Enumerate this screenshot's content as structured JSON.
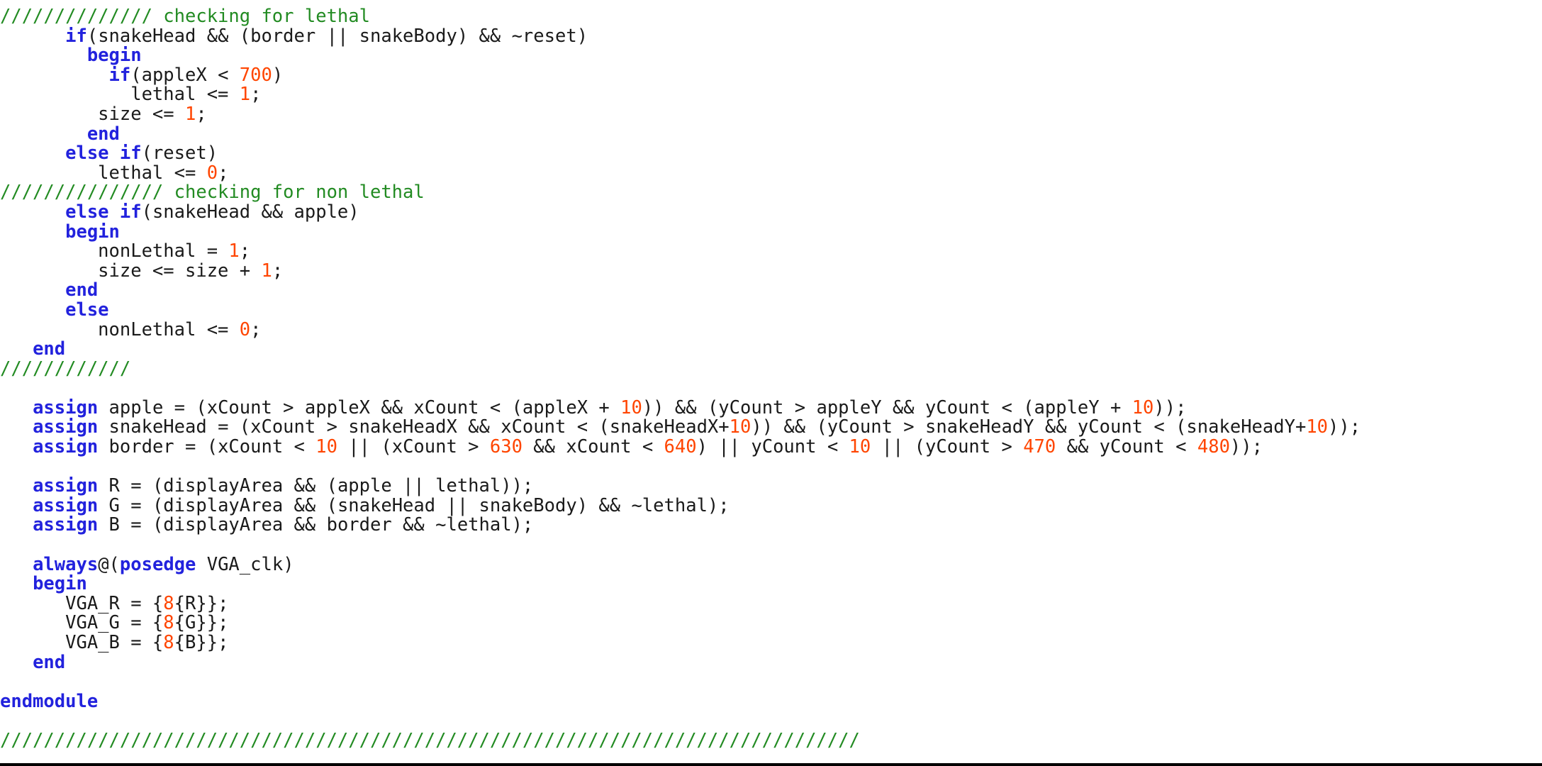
{
  "document": {
    "language": "Verilog",
    "background_color": "#ffffff",
    "colors": {
      "comment": "#228B22",
      "keyword": "#2222dd",
      "number": "#ff4500",
      "text": "#1a1a1a",
      "rule": "#000000"
    },
    "lines": [
      {
        "indent": 0,
        "tokens": [
          {
            "type": "comment",
            "text": "////////////// checking for lethal"
          }
        ]
      },
      {
        "indent": 0,
        "tokens": [
          {
            "type": "plain",
            "text": "      "
          },
          {
            "type": "keyword",
            "text": "if"
          },
          {
            "type": "plain",
            "text": "(snakeHead && (border || snakeBody) && ~reset)"
          }
        ]
      },
      {
        "indent": 0,
        "tokens": [
          {
            "type": "plain",
            "text": "        "
          },
          {
            "type": "keyword",
            "text": "begin"
          }
        ]
      },
      {
        "indent": 0,
        "tokens": [
          {
            "type": "plain",
            "text": "          "
          },
          {
            "type": "keyword",
            "text": "if"
          },
          {
            "type": "plain",
            "text": "(appleX < "
          },
          {
            "type": "number",
            "text": "700"
          },
          {
            "type": "plain",
            "text": ")"
          }
        ]
      },
      {
        "indent": 0,
        "tokens": [
          {
            "type": "plain",
            "text": "            lethal <= "
          },
          {
            "type": "number",
            "text": "1"
          },
          {
            "type": "plain",
            "text": ";"
          }
        ]
      },
      {
        "indent": 0,
        "tokens": [
          {
            "type": "plain",
            "text": "         size <= "
          },
          {
            "type": "number",
            "text": "1"
          },
          {
            "type": "plain",
            "text": ";"
          }
        ]
      },
      {
        "indent": 0,
        "tokens": [
          {
            "type": "plain",
            "text": "        "
          },
          {
            "type": "keyword",
            "text": "end"
          }
        ]
      },
      {
        "indent": 0,
        "tokens": [
          {
            "type": "plain",
            "text": "      "
          },
          {
            "type": "keyword",
            "text": "else if"
          },
          {
            "type": "plain",
            "text": "(reset)"
          }
        ]
      },
      {
        "indent": 0,
        "tokens": [
          {
            "type": "plain",
            "text": "         lethal <= "
          },
          {
            "type": "number",
            "text": "0"
          },
          {
            "type": "plain",
            "text": ";"
          }
        ]
      },
      {
        "indent": 0,
        "tokens": [
          {
            "type": "comment",
            "text": "/////////////// checking for non lethal"
          }
        ]
      },
      {
        "indent": 0,
        "tokens": [
          {
            "type": "plain",
            "text": "      "
          },
          {
            "type": "keyword",
            "text": "else if"
          },
          {
            "type": "plain",
            "text": "(snakeHead && apple)"
          }
        ]
      },
      {
        "indent": 0,
        "tokens": [
          {
            "type": "plain",
            "text": "      "
          },
          {
            "type": "keyword",
            "text": "begin"
          }
        ]
      },
      {
        "indent": 0,
        "tokens": [
          {
            "type": "plain",
            "text": "         nonLethal = "
          },
          {
            "type": "number",
            "text": "1"
          },
          {
            "type": "plain",
            "text": ";"
          }
        ]
      },
      {
        "indent": 0,
        "tokens": [
          {
            "type": "plain",
            "text": "         size <= size + "
          },
          {
            "type": "number",
            "text": "1"
          },
          {
            "type": "plain",
            "text": ";"
          }
        ]
      },
      {
        "indent": 0,
        "tokens": [
          {
            "type": "plain",
            "text": "      "
          },
          {
            "type": "keyword",
            "text": "end"
          }
        ]
      },
      {
        "indent": 0,
        "tokens": [
          {
            "type": "plain",
            "text": "      "
          },
          {
            "type": "keyword",
            "text": "else"
          }
        ]
      },
      {
        "indent": 0,
        "tokens": [
          {
            "type": "plain",
            "text": "         nonLethal <= "
          },
          {
            "type": "number",
            "text": "0"
          },
          {
            "type": "plain",
            "text": ";"
          }
        ]
      },
      {
        "indent": 0,
        "tokens": [
          {
            "type": "plain",
            "text": "   "
          },
          {
            "type": "keyword",
            "text": "end"
          }
        ]
      },
      {
        "indent": 0,
        "tokens": [
          {
            "type": "comment",
            "text": "////////////"
          }
        ]
      },
      {
        "indent": 0,
        "tokens": []
      },
      {
        "indent": 0,
        "tokens": [
          {
            "type": "plain",
            "text": "   "
          },
          {
            "type": "keyword",
            "text": "assign"
          },
          {
            "type": "plain",
            "text": " apple = (xCount > appleX && xCount < (appleX + "
          },
          {
            "type": "number",
            "text": "10"
          },
          {
            "type": "plain",
            "text": ")) && (yCount > appleY && yCount < (appleY + "
          },
          {
            "type": "number",
            "text": "10"
          },
          {
            "type": "plain",
            "text": "));"
          }
        ]
      },
      {
        "indent": 0,
        "tokens": [
          {
            "type": "plain",
            "text": "   "
          },
          {
            "type": "keyword",
            "text": "assign"
          },
          {
            "type": "plain",
            "text": " snakeHead = (xCount > snakeHeadX && xCount < (snakeHeadX+"
          },
          {
            "type": "number",
            "text": "10"
          },
          {
            "type": "plain",
            "text": ")) && (yCount > snakeHeadY && yCount < (snakeHeadY+"
          },
          {
            "type": "number",
            "text": "10"
          },
          {
            "type": "plain",
            "text": "));"
          }
        ]
      },
      {
        "indent": 0,
        "tokens": [
          {
            "type": "plain",
            "text": "   "
          },
          {
            "type": "keyword",
            "text": "assign"
          },
          {
            "type": "plain",
            "text": " border = (xCount < "
          },
          {
            "type": "number",
            "text": "10"
          },
          {
            "type": "plain",
            "text": " || (xCount > "
          },
          {
            "type": "number",
            "text": "630"
          },
          {
            "type": "plain",
            "text": " && xCount < "
          },
          {
            "type": "number",
            "text": "640"
          },
          {
            "type": "plain",
            "text": ") || yCount < "
          },
          {
            "type": "number",
            "text": "10"
          },
          {
            "type": "plain",
            "text": " || (yCount > "
          },
          {
            "type": "number",
            "text": "470"
          },
          {
            "type": "plain",
            "text": " && yCount < "
          },
          {
            "type": "number",
            "text": "480"
          },
          {
            "type": "plain",
            "text": "));"
          }
        ]
      },
      {
        "indent": 0,
        "tokens": []
      },
      {
        "indent": 0,
        "tokens": [
          {
            "type": "plain",
            "text": "   "
          },
          {
            "type": "keyword",
            "text": "assign"
          },
          {
            "type": "plain",
            "text": " R = (displayArea && (apple || lethal));"
          }
        ]
      },
      {
        "indent": 0,
        "tokens": [
          {
            "type": "plain",
            "text": "   "
          },
          {
            "type": "keyword",
            "text": "assign"
          },
          {
            "type": "plain",
            "text": " G = (displayArea && (snakeHead || snakeBody) && ~lethal);"
          }
        ]
      },
      {
        "indent": 0,
        "tokens": [
          {
            "type": "plain",
            "text": "   "
          },
          {
            "type": "keyword",
            "text": "assign"
          },
          {
            "type": "plain",
            "text": " B = (displayArea && border && ~lethal);"
          }
        ]
      },
      {
        "indent": 0,
        "tokens": []
      },
      {
        "indent": 0,
        "tokens": [
          {
            "type": "plain",
            "text": "   "
          },
          {
            "type": "keyword",
            "text": "always"
          },
          {
            "type": "plain",
            "text": "@("
          },
          {
            "type": "keyword",
            "text": "posedge"
          },
          {
            "type": "plain",
            "text": " VGA_clk)"
          }
        ]
      },
      {
        "indent": 0,
        "tokens": [
          {
            "type": "plain",
            "text": "   "
          },
          {
            "type": "keyword",
            "text": "begin"
          }
        ]
      },
      {
        "indent": 0,
        "tokens": [
          {
            "type": "plain",
            "text": "      VGA_R = {"
          },
          {
            "type": "number",
            "text": "8"
          },
          {
            "type": "plain",
            "text": "{R}};"
          }
        ]
      },
      {
        "indent": 0,
        "tokens": [
          {
            "type": "plain",
            "text": "      VGA_G = {"
          },
          {
            "type": "number",
            "text": "8"
          },
          {
            "type": "plain",
            "text": "{G}};"
          }
        ]
      },
      {
        "indent": 0,
        "tokens": [
          {
            "type": "plain",
            "text": "      VGA_B = {"
          },
          {
            "type": "number",
            "text": "8"
          },
          {
            "type": "plain",
            "text": "{B}};"
          }
        ]
      },
      {
        "indent": 0,
        "tokens": [
          {
            "type": "plain",
            "text": "   "
          },
          {
            "type": "keyword",
            "text": "end"
          }
        ]
      },
      {
        "indent": 0,
        "tokens": []
      },
      {
        "indent": 0,
        "tokens": [
          {
            "type": "keyword",
            "text": "endmodule"
          }
        ]
      },
      {
        "indent": 0,
        "tokens": []
      },
      {
        "indent": 0,
        "tokens": [
          {
            "type": "comment",
            "text": "///////////////////////////////////////////////////////////////////////////////"
          }
        ]
      }
    ]
  }
}
